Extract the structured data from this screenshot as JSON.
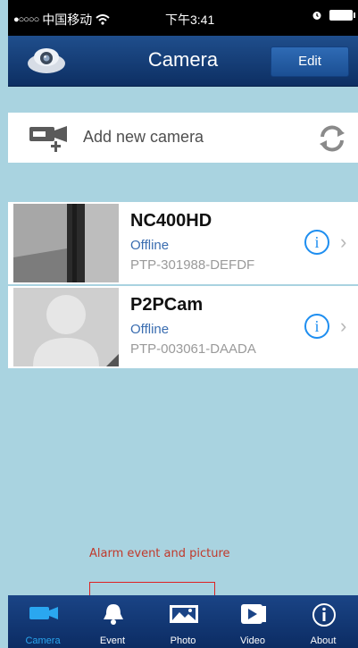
{
  "status_bar": {
    "signal": "●○○○○",
    "carrier": "中国移动",
    "wifi": "wifi-icon",
    "time": "下午3:41",
    "alarm": "alarm-icon",
    "battery": "battery-icon"
  },
  "nav": {
    "title": "Camera",
    "edit_label": "Edit",
    "logo": "app-logo-icon"
  },
  "add_camera": {
    "label": "Add new camera",
    "icon": "add-camera-icon",
    "refresh_icon": "refresh-icon"
  },
  "cameras": [
    {
      "name": "NC400HD",
      "status": "Offline",
      "uid": "PTP-301988-DEFDF",
      "info_icon": "info-icon",
      "chevron": "chevron-right-icon"
    },
    {
      "name": "P2PCam",
      "status": "Offline",
      "uid": "PTP-003061-DAADA",
      "info_icon": "info-icon",
      "chevron": "chevron-right-icon"
    }
  ],
  "annotation": {
    "text": "Alarm event and picture"
  },
  "tabs": [
    {
      "label": "Camera",
      "icon": "camera-icon",
      "active": true
    },
    {
      "label": "Event",
      "icon": "bell-icon",
      "active": false
    },
    {
      "label": "Photo",
      "icon": "photo-icon",
      "active": false
    },
    {
      "label": "Video",
      "icon": "video-icon",
      "active": false
    },
    {
      "label": "About",
      "icon": "info-icon",
      "active": false
    }
  ],
  "colors": {
    "background": "#a9d3e0",
    "nav": "#1f4e8c",
    "accent": "#2aa7f0",
    "status_text": "#3a6db0",
    "annotation": "#c0392b"
  }
}
